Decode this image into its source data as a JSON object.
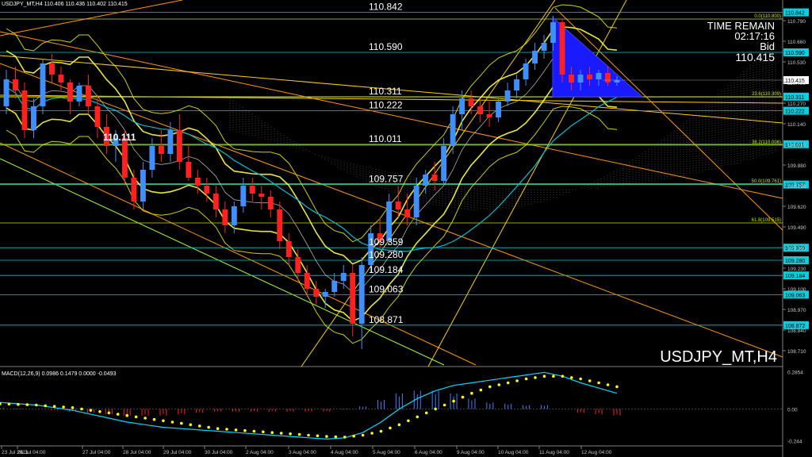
{
  "window": {
    "header": "USDJPY_MT,H4  110.406 110.436 110.402 110.415",
    "symbol_watermark": "USDJPY_MT,H4",
    "time_remain_label": "TIME REMAIN",
    "time_remain_value": "02:17:16",
    "bid_label": "Bid",
    "bid_value": "110.415"
  },
  "colors": {
    "background": "#000000",
    "bull_candle": "#3f8fff",
    "bear_candle": "#ff2020",
    "level_line": "#00c8c8",
    "fib_line": "#c8e000",
    "bollinger": "#ffff40",
    "channel": "#ff9900",
    "macd_line": "#00d8ff",
    "macd_signal": "#ffff00",
    "price_tag": "#00d0e0"
  },
  "chart_data": [
    {
      "type": "candlestick",
      "title": "USDJPY_MT,H4",
      "ylim": [
        108.62,
        110.87
      ],
      "y_axis_ticks": [
        "110.920",
        "110.790",
        "110.660",
        "110.530",
        "110.400",
        "110.270",
        "110.140",
        "110.010",
        "109.880",
        "109.750",
        "109.620",
        "109.490",
        "109.360",
        "109.230",
        "109.100",
        "108.970",
        "108.840",
        "108.710"
      ],
      "x_axis_ticks": [
        "23 Jul 2021",
        "26 Jul 04:00",
        "27 Jul 04:00",
        "28 Jul 04:00",
        "29 Jul 04:00",
        "30 Jul 04:00",
        "2 Aug 04:00",
        "3 Aug 04:00",
        "4 Aug 04:00",
        "5 Aug 04:00",
        "6 Aug 04:00",
        "9 Aug 04:00",
        "10 Aug 04:00",
        "11 Aug 04:00",
        "12 Aug 04:00"
      ],
      "price_levels": [
        {
          "label": "110.842",
          "value": 110.842,
          "tag": "110.842"
        },
        {
          "label": "110.590",
          "value": 110.59,
          "tag": "110.590"
        },
        {
          "label": "110.311",
          "value": 110.311,
          "tag": "110.311"
        },
        {
          "label": "110.222",
          "value": 110.222,
          "tag": "110.222"
        },
        {
          "label": "110.011",
          "value": 110.011,
          "tag": "110.011"
        },
        {
          "label": "109.757",
          "value": 109.757,
          "tag": "109.757"
        },
        {
          "label": "109.359",
          "value": 109.359,
          "tag": "109.359"
        },
        {
          "label": "109.280",
          "value": 109.28,
          "tag": "109.280"
        },
        {
          "label": "109.184",
          "value": 109.184,
          "tag": "109.184"
        },
        {
          "label": "109.063",
          "value": 109.063,
          "tag": "109.063"
        },
        {
          "label": "108.871",
          "value": 108.871,
          "tag": "108.872"
        }
      ],
      "fib_levels": [
        {
          "label": "0.0(110.800)",
          "value": 110.8
        },
        {
          "label": "23.6(110.309)",
          "value": 110.309
        },
        {
          "label": "38.2(110.006)",
          "value": 110.006
        },
        {
          "label": "50.0(109.761)",
          "value": 109.761
        },
        {
          "label": "61.8(109.515)",
          "value": 109.515
        }
      ],
      "current_price": {
        "value": 110.415,
        "tag": "110.415"
      },
      "annotation": {
        "label": "110.111",
        "value": 110.111
      },
      "ohlc": [
        [
          110.25,
          110.48,
          110.2,
          110.42
        ],
        [
          110.42,
          110.5,
          110.3,
          110.35
        ],
        [
          110.35,
          110.4,
          110.05,
          110.1
        ],
        [
          110.1,
          110.3,
          110.05,
          110.25
        ],
        [
          110.25,
          110.55,
          110.2,
          110.52
        ],
        [
          110.52,
          110.58,
          110.4,
          110.45
        ],
        [
          110.45,
          110.5,
          110.35,
          110.4
        ],
        [
          110.4,
          110.42,
          110.2,
          110.28
        ],
        [
          110.28,
          110.4,
          110.25,
          110.38
        ],
        [
          110.38,
          110.45,
          110.2,
          110.25
        ],
        [
          110.25,
          110.32,
          110.05,
          110.12
        ],
        [
          110.12,
          110.2,
          109.95,
          110.0
        ],
        [
          110.0,
          110.1,
          109.9,
          110.05
        ],
        [
          110.05,
          110.1,
          109.75,
          109.8
        ],
        [
          109.8,
          109.85,
          109.6,
          109.65
        ],
        [
          109.65,
          109.9,
          109.6,
          109.85
        ],
        [
          109.85,
          110.05,
          109.8,
          110.0
        ],
        [
          110.0,
          110.1,
          109.9,
          109.95
        ],
        [
          109.95,
          110.15,
          109.9,
          110.1
        ],
        [
          110.1,
          110.2,
          109.85,
          109.9
        ],
        [
          109.9,
          110.0,
          109.78,
          109.8
        ],
        [
          109.8,
          109.85,
          109.7,
          109.75
        ],
        [
          109.75,
          109.8,
          109.65,
          109.7
        ],
        [
          109.7,
          109.75,
          109.55,
          109.6
        ],
        [
          109.6,
          109.65,
          109.45,
          109.5
        ],
        [
          109.5,
          109.65,
          109.45,
          109.62
        ],
        [
          109.62,
          109.8,
          109.58,
          109.75
        ],
        [
          109.75,
          109.8,
          109.65,
          109.7
        ],
        [
          109.7,
          109.75,
          109.6,
          109.68
        ],
        [
          109.68,
          109.72,
          109.55,
          109.6
        ],
        [
          109.6,
          109.65,
          109.35,
          109.4
        ],
        [
          109.4,
          109.45,
          109.25,
          109.3
        ],
        [
          109.3,
          109.35,
          109.15,
          109.2
        ],
        [
          109.2,
          109.25,
          109.05,
          109.1
        ],
        [
          109.1,
          109.15,
          109.0,
          109.05
        ],
        [
          109.05,
          109.1,
          108.98,
          109.08
        ],
        [
          109.08,
          109.2,
          109.05,
          109.15
        ],
        [
          109.15,
          109.25,
          109.1,
          109.2
        ],
        [
          109.2,
          109.25,
          108.8,
          108.88
        ],
        [
          108.88,
          109.3,
          108.72,
          109.25
        ],
        [
          109.25,
          109.5,
          109.2,
          109.45
        ],
        [
          109.45,
          109.55,
          109.35,
          109.4
        ],
        [
          109.4,
          109.7,
          109.38,
          109.65
        ],
        [
          109.65,
          109.75,
          109.55,
          109.6
        ],
        [
          109.6,
          109.7,
          109.5,
          109.55
        ],
        [
          109.55,
          109.8,
          109.5,
          109.75
        ],
        [
          109.75,
          109.85,
          109.7,
          109.82
        ],
        [
          109.82,
          109.9,
          109.72,
          109.78
        ],
        [
          109.78,
          110.05,
          109.75,
          110.0
        ],
        [
          110.0,
          110.25,
          109.95,
          110.2
        ],
        [
          110.2,
          110.35,
          110.1,
          110.3
        ],
        [
          110.3,
          110.35,
          110.2,
          110.25
        ],
        [
          110.25,
          110.3,
          110.15,
          110.2
        ],
        [
          110.2,
          110.28,
          110.12,
          110.18
        ],
        [
          110.18,
          110.3,
          110.15,
          110.28
        ],
        [
          110.28,
          110.4,
          110.25,
          110.35
        ],
        [
          110.35,
          110.45,
          110.3,
          110.42
        ],
        [
          110.42,
          110.55,
          110.38,
          110.52
        ],
        [
          110.52,
          110.65,
          110.48,
          110.6
        ],
        [
          110.6,
          110.7,
          110.55,
          110.65
        ],
        [
          110.65,
          110.82,
          110.6,
          110.78
        ],
        [
          110.78,
          110.8,
          110.4,
          110.45
        ],
        [
          110.45,
          110.5,
          110.35,
          110.4
        ],
        [
          110.4,
          110.48,
          110.35,
          110.45
        ],
        [
          110.45,
          110.5,
          110.38,
          110.42
        ],
        [
          110.42,
          110.48,
          110.38,
          110.46
        ],
        [
          110.46,
          110.5,
          110.38,
          110.4
        ],
        [
          110.4,
          110.44,
          110.38,
          110.415
        ]
      ]
    },
    {
      "type": "line",
      "title": "MACD(12,26,9) 0.0986 0.1479 0.0000 -0.0493",
      "ylim": [
        -0.27,
        0.3
      ],
      "y_axis_ticks": [
        "0.2854",
        "0.00",
        "-0.244"
      ],
      "series": [
        {
          "name": "MACD",
          "values": [
            0.05,
            0.04,
            0.03,
            0.01,
            -0.01,
            -0.04,
            -0.07,
            -0.1,
            -0.12,
            -0.14,
            -0.15,
            -0.16,
            -0.17,
            -0.18,
            -0.19,
            -0.2,
            -0.21,
            -0.22,
            -0.23,
            -0.22,
            -0.18,
            -0.1,
            0.0,
            0.08,
            0.14,
            0.18,
            0.2,
            0.22,
            0.24,
            0.26,
            0.28,
            0.25,
            0.2,
            0.16,
            0.12
          ]
        },
        {
          "name": "Signal",
          "values": [
            0.04,
            0.035,
            0.03,
            0.02,
            0.01,
            -0.01,
            -0.03,
            -0.05,
            -0.07,
            -0.09,
            -0.11,
            -0.13,
            -0.15,
            -0.16,
            -0.17,
            -0.18,
            -0.19,
            -0.2,
            -0.21,
            -0.215,
            -0.2,
            -0.17,
            -0.12,
            -0.06,
            0.0,
            0.06,
            0.12,
            0.17,
            0.2,
            0.23,
            0.25,
            0.25,
            0.23,
            0.2,
            0.17
          ]
        }
      ]
    }
  ]
}
